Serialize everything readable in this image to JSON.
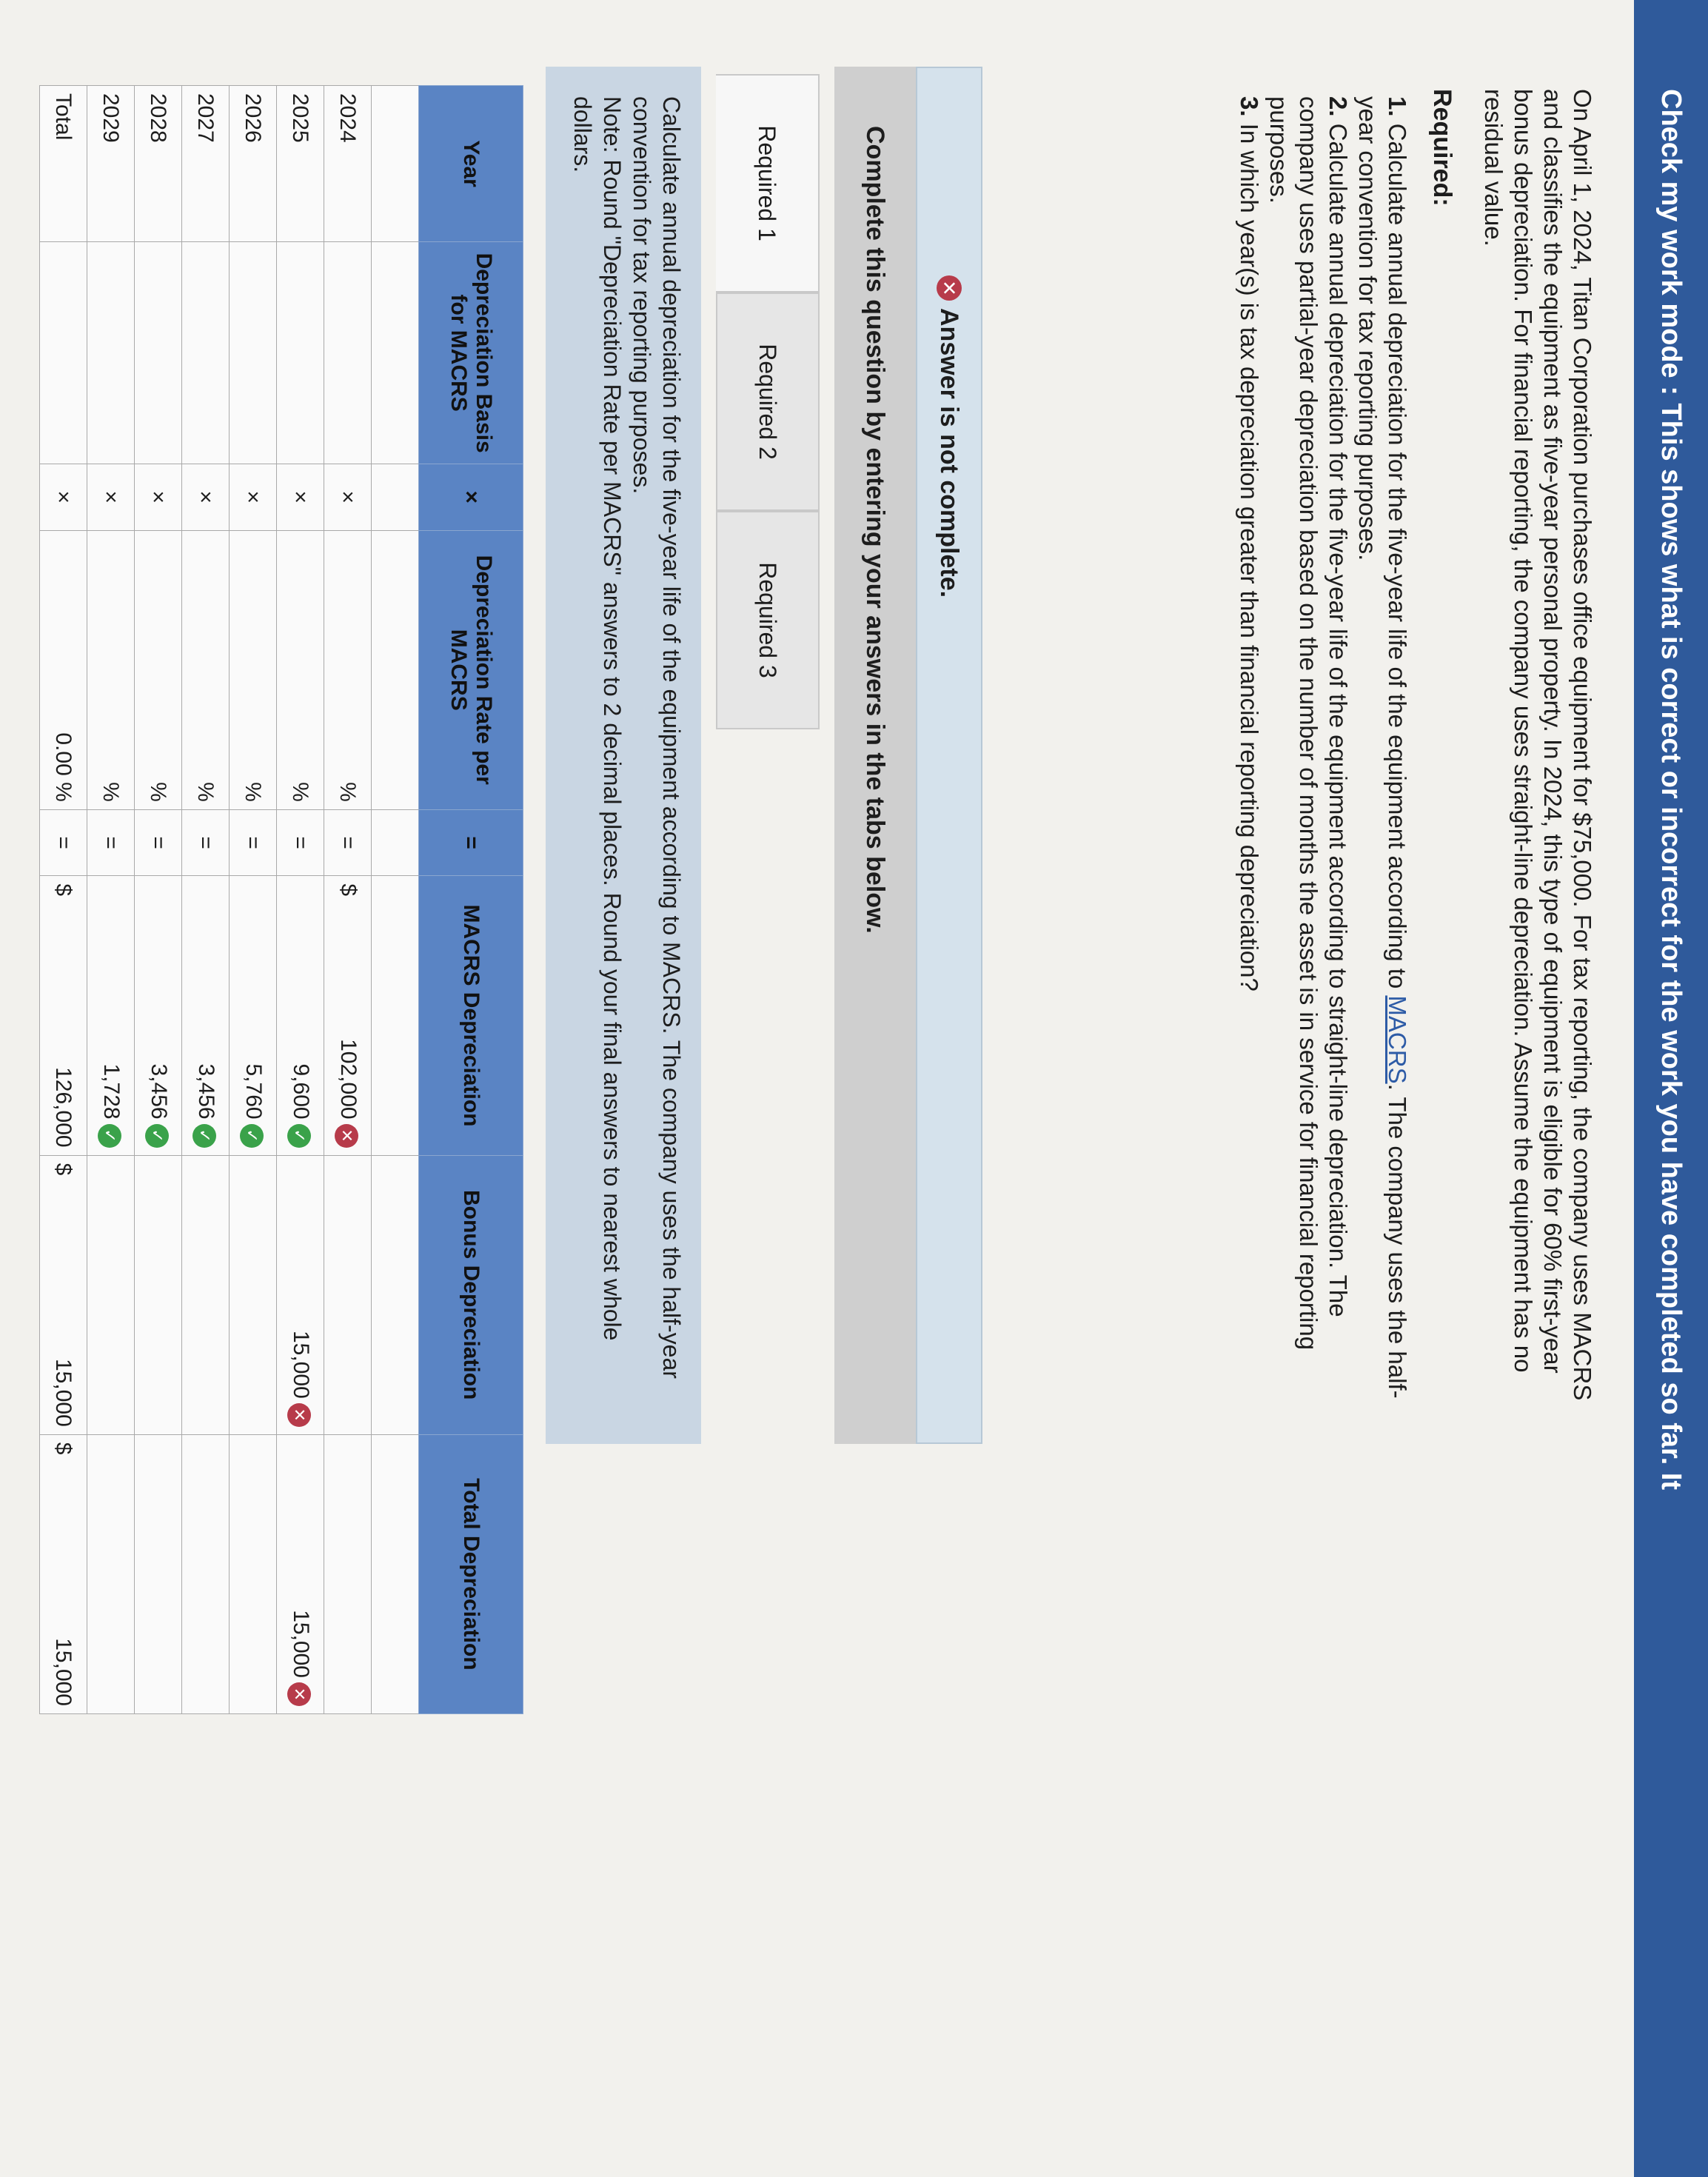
{
  "banner": "Check my work mode : This shows what is correct or incorrect for the work you have completed so far. It",
  "problem": {
    "text_before_link": "On April 1, 2024, Titan Corporation purchases office equipment for $75,000. For tax reporting, the company uses MACRS and classifies the equipment as five-year personal property. In 2024, this type of equipment is eligible for 60% first-year bonus depreciation. For financial reporting, the company uses straight-line depreciation. Assume the equipment has no residual value."
  },
  "required": {
    "title": "Required:",
    "items": [
      {
        "num": "1.",
        "before": "Calculate annual depreciation for the five-year life of the equipment according to ",
        "link": "MACRS",
        "after": ". The company uses the half-year convention for tax reporting purposes."
      },
      {
        "num": "2.",
        "before": "Calculate annual depreciation for the five-year life of the equipment according to straight-line depreciation. The company uses partial-year depreciation based on the number of months the asset is in service for financial reporting purposes.",
        "link": "",
        "after": ""
      },
      {
        "num": "3.",
        "before": "In which year(s) is tax depreciation greater than financial reporting depreciation?",
        "link": "",
        "after": ""
      }
    ]
  },
  "status": {
    "icon": "x-circle-icon",
    "text": "Answer is not complete."
  },
  "complete_prompt": "Complete this question by entering your answers in the tabs below.",
  "tabs": [
    "Required 1",
    "Required 2",
    "Required 3"
  ],
  "instruction": {
    "line1": "Calculate annual depreciation for the five-year life of the equipment according to MACRS. The company uses the half-year convention for tax reporting purposes.",
    "line2": "Note: Round \"Depreciation Rate per MACRS\" answers to 2 decimal places. Round your final answers to nearest whole dollars."
  },
  "table": {
    "headers": {
      "year": "Year",
      "basis": "Depreciation Basis for MACRS",
      "times": "×",
      "rate": "Depreciation Rate per MACRS",
      "equals": "=",
      "macrs": "MACRS Depreciation",
      "bonus": "Bonus Depreciation",
      "total": "Total Depreciation"
    },
    "rows": [
      {
        "year": "2024",
        "times": "×",
        "pct": "%",
        "equals": "=",
        "dollar": "$",
        "macrs": "102,000",
        "macrs_status": "incorrect",
        "bonus": "",
        "bonus_status": "",
        "total": "",
        "total_status": ""
      },
      {
        "year": "2025",
        "times": "×",
        "pct": "%",
        "equals": "=",
        "dollar": "",
        "macrs": "9,600",
        "macrs_status": "correct",
        "bonus": "15,000",
        "bonus_status": "incorrect",
        "total": "15,000",
        "total_status": "incorrect"
      },
      {
        "year": "2026",
        "times": "×",
        "pct": "%",
        "equals": "=",
        "dollar": "",
        "macrs": "5,760",
        "macrs_status": "correct",
        "bonus": "",
        "bonus_status": "",
        "total": "",
        "total_status": ""
      },
      {
        "year": "2027",
        "times": "×",
        "pct": "%",
        "equals": "=",
        "dollar": "",
        "macrs": "3,456",
        "macrs_status": "correct",
        "bonus": "",
        "bonus_status": "",
        "total": "",
        "total_status": ""
      },
      {
        "year": "2028",
        "times": "×",
        "pct": "%",
        "equals": "=",
        "dollar": "",
        "macrs": "3,456",
        "macrs_status": "correct",
        "bonus": "",
        "bonus_status": "",
        "total": "",
        "total_status": ""
      },
      {
        "year": "2029",
        "times": "×",
        "pct": "%",
        "equals": "=",
        "dollar": "",
        "macrs": "1,728",
        "macrs_status": "correct",
        "bonus": "",
        "bonus_status": "",
        "total": "",
        "total_status": ""
      }
    ],
    "total_row": {
      "year": "Total",
      "times": "×",
      "basis": "0.00",
      "pct": "%",
      "equals": "=",
      "dollar": "$",
      "macrs": "126,000",
      "bonus_dollar": "$",
      "bonus": "15,000",
      "total_dollar": "$",
      "total": "15,000"
    }
  },
  "colors": {
    "banner": "#2f5a9b",
    "header": "#5a84c4",
    "correct": "#3aa24a",
    "incorrect": "#b73b4a"
  }
}
